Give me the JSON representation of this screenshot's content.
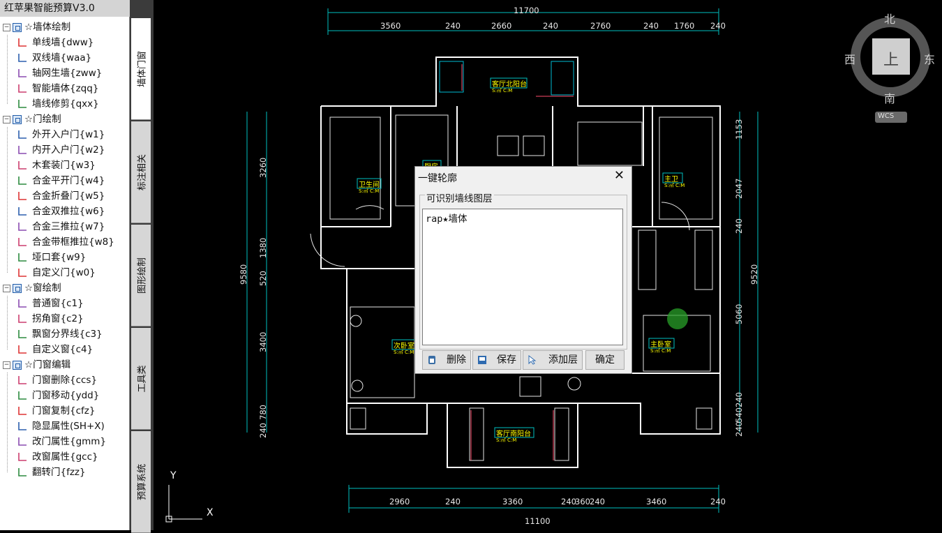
{
  "app": {
    "title": "红苹果智能预算V3.0"
  },
  "tree": {
    "groups": [
      {
        "label": "☆墙体绘制",
        "items": [
          "单线墙{dww}",
          "双线墙{waa}",
          "轴网生墙{zww}",
          "智能墙体{zqq}",
          "墙线修剪{qxx}"
        ]
      },
      {
        "label": "☆门绘制",
        "items": [
          "外开入户门{w1}",
          "内开入户门{w2}",
          "木套装门{w3}",
          "合金平开门{w4}",
          "合金折叠门{w5}",
          "合金双推拉{w6}",
          "合金三推拉{w7}",
          "合金带框推拉{w8}",
          "垭口套{w9}",
          "自定义门{w0}"
        ]
      },
      {
        "label": "☆窗绘制",
        "items": [
          "普通窗{c1}",
          "拐角窗{c2}",
          "飘窗分界线{c3}",
          "自定义窗{c4}"
        ]
      },
      {
        "label": "☆门窗编辑",
        "items": [
          "门窗删除{ccs}",
          "门窗移动{ydd}",
          "门窗复制{cfz}",
          "隐显属性(SH+X)",
          "改门属性{gmm}",
          "改窗属性{gcc}",
          "翻转门{fzz}"
        ]
      }
    ]
  },
  "tabs": [
    "墙体门窗",
    "标注相关",
    "图形绘制",
    "工具类",
    "预算系统"
  ],
  "compass": {
    "north": "北",
    "south": "南",
    "east": "东",
    "west": "西",
    "center": "上",
    "ucs": "WCS"
  },
  "dims": {
    "top_total": "11700",
    "top": [
      "3560",
      "240",
      "2660",
      "240",
      "2760",
      "240",
      "1760",
      "240"
    ],
    "bottom": [
      "2960",
      "240",
      "3360",
      "240",
      "360",
      "240",
      "3460",
      "240"
    ],
    "bottom_total": "11100",
    "left": [
      "3260",
      "1380",
      "520",
      "3400",
      "780",
      "240"
    ],
    "left_total": "9580",
    "right": [
      "1153",
      "2047",
      "240",
      "5060",
      "240",
      "540",
      "240"
    ],
    "right_total": "9520"
  },
  "rooms": {
    "north_balcony": "客厅北阳台",
    "bath_left": "卫生间",
    "kitchen": "厨房",
    "bath_right": "主卫",
    "second_bedroom": "次卧室",
    "master_bedroom": "主卧室",
    "south_balcony": "客厅南阳台",
    "area_tag": "S:㎡ C:M"
  },
  "axis": {
    "y": "Y",
    "x": "X"
  },
  "dialog": {
    "title": "一键轮廓",
    "group_label": "可识别墙线图层",
    "list_items": [
      "rap★墙体"
    ],
    "btn_delete": "删除",
    "btn_save": "保存",
    "btn_addlayer": "添加层",
    "btn_ok": "确定"
  }
}
